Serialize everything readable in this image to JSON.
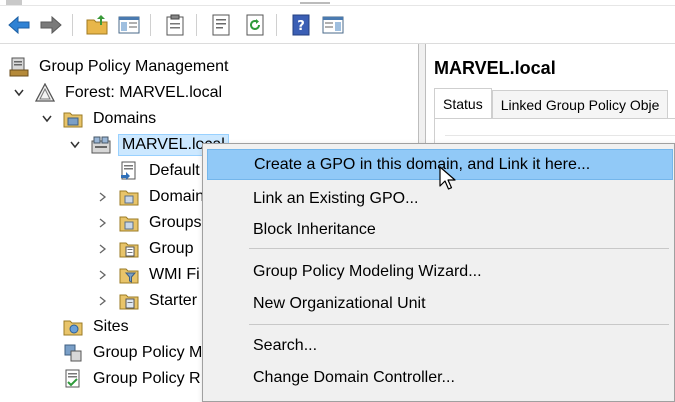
{
  "toolbar": {
    "buttons": [
      "back-arrow-icon",
      "forward-arrow-icon",
      "folder-up-icon",
      "show-hide-tree-icon",
      "clipboard-icon",
      "properties-icon",
      "refresh-icon",
      "help-icon",
      "action-pane-icon"
    ]
  },
  "tree": {
    "root": "Group Policy Management",
    "forest": "Forest: MARVEL.local",
    "domains": "Domains",
    "domain": "MARVEL.local",
    "children": [
      "Default",
      "Domain",
      "Groups",
      "Group",
      "WMI Fi",
      "Starter"
    ],
    "sites": "Sites",
    "modeling": "Group Policy M",
    "results": "Group Policy R"
  },
  "right_pane": {
    "title": "MARVEL.local",
    "tabs": [
      "Status",
      "Linked Group Policy Obje"
    ]
  },
  "context_menu": {
    "items": [
      "Create a GPO in this domain, and Link it here...",
      "Link an Existing GPO...",
      "Block Inheritance",
      "Group Policy Modeling Wizard...",
      "New Organizational Unit",
      "Search...",
      "Change Domain Controller..."
    ]
  },
  "colors": {
    "menu_hover": "#91c9f7",
    "selection": "#cce8ff",
    "menu_bg": "#f0f0f0",
    "accent_blue": "#2b79c2"
  }
}
